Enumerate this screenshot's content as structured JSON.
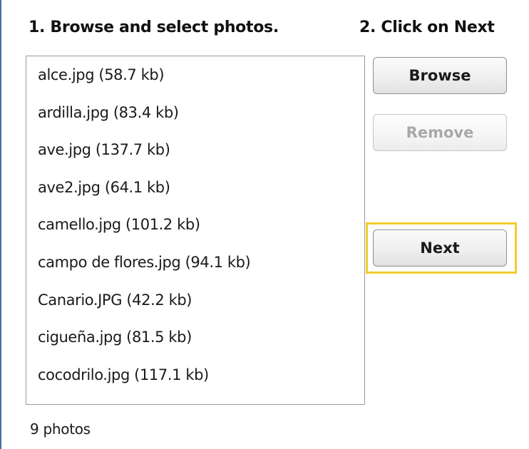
{
  "steps": {
    "step1_label": "1. Browse and select photos.",
    "step2_label": "2. Click on Next"
  },
  "photos": [
    {
      "label": "alce.jpg (58.7 kb)"
    },
    {
      "label": "ardilla.jpg (83.4 kb)"
    },
    {
      "label": "ave.jpg (137.7 kb)"
    },
    {
      "label": "ave2.jpg (64.1 kb)"
    },
    {
      "label": "camello.jpg (101.2 kb)"
    },
    {
      "label": "campo de flores.jpg (94.1 kb)"
    },
    {
      "label": "Canario.JPG (42.2 kb)"
    },
    {
      "label": "cigueña.jpg (81.5 kb)"
    },
    {
      "label": "cocodrilo.jpg (117.1 kb)"
    }
  ],
  "buttons": {
    "browse_label": "Browse",
    "remove_label": "Remove",
    "next_label": "Next",
    "remove_disabled": true
  },
  "status": {
    "photo_count": "9 photos"
  },
  "colors": {
    "highlight": "#f2cc2e",
    "panel_border": "#4a6fa3",
    "disabled_text": "#a8a8a8"
  }
}
